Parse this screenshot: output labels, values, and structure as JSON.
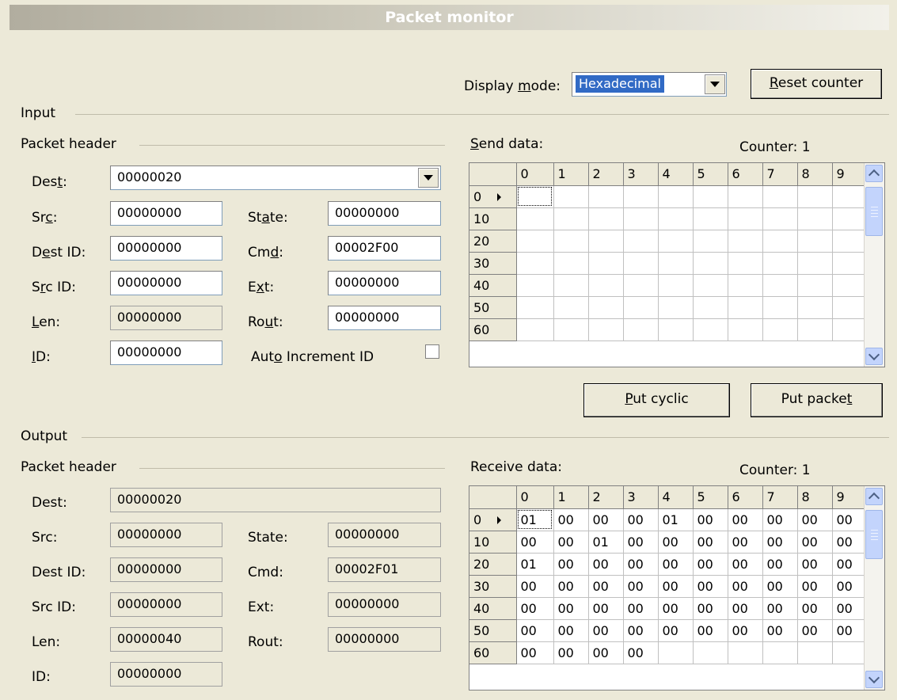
{
  "window": {
    "title": "Packet monitor"
  },
  "display_mode": {
    "label": "Display mode:",
    "value": "Hexadecimal"
  },
  "reset_counter": "Reset counter",
  "input": {
    "group": "Input",
    "header_group": "Packet header",
    "dest_label": "Dest:",
    "dest": "00000020",
    "src_label": "Src:",
    "src": "00000000",
    "dest_id_label": "Dest ID:",
    "dest_id": "00000000",
    "src_id_label": "Src ID:",
    "src_id": "00000000",
    "len_label": "Len:",
    "len": "00000000",
    "id_label": "ID:",
    "id": "00000000",
    "state_label": "State:",
    "state": "00000000",
    "cmd_label": "Cmd:",
    "cmd": "00002F00",
    "ext_label": "Ext:",
    "ext": "00000000",
    "rout_label": "Rout:",
    "rout": "00000000",
    "auto_increment_label": "Auto Increment ID",
    "send_data_label": "Send data:",
    "counter": "Counter: 1",
    "columns": [
      "0",
      "1",
      "2",
      "3",
      "4",
      "5",
      "6",
      "7",
      "8",
      "9"
    ],
    "rows": [
      {
        "label": "0",
        "cells": [
          "",
          "",
          "",
          "",
          "",
          "",
          "",
          "",
          "",
          ""
        ]
      },
      {
        "label": "10",
        "cells": [
          "",
          "",
          "",
          "",
          "",
          "",
          "",
          "",
          "",
          ""
        ]
      },
      {
        "label": "20",
        "cells": [
          "",
          "",
          "",
          "",
          "",
          "",
          "",
          "",
          "",
          ""
        ]
      },
      {
        "label": "30",
        "cells": [
          "",
          "",
          "",
          "",
          "",
          "",
          "",
          "",
          "",
          ""
        ]
      },
      {
        "label": "40",
        "cells": [
          "",
          "",
          "",
          "",
          "",
          "",
          "",
          "",
          "",
          ""
        ]
      },
      {
        "label": "50",
        "cells": [
          "",
          "",
          "",
          "",
          "",
          "",
          "",
          "",
          "",
          ""
        ]
      },
      {
        "label": "60",
        "cells": [
          "",
          "",
          "",
          "",
          "",
          "",
          "",
          "",
          "",
          ""
        ]
      }
    ]
  },
  "buttons": {
    "put_cyclic": "Put cyclic",
    "put_packet": "Put packet"
  },
  "output": {
    "group": "Output",
    "header_group": "Packet header",
    "dest_label": "Dest:",
    "dest": "00000020",
    "src_label": "Src:",
    "src": "00000000",
    "dest_id_label": "Dest ID:",
    "dest_id": "00000000",
    "src_id_label": "Src ID:",
    "src_id": "00000000",
    "len_label": "Len:",
    "len": "00000040",
    "id_label": "ID:",
    "id": "00000000",
    "state_label": "State:",
    "state": "00000000",
    "cmd_label": "Cmd:",
    "cmd": "00002F01",
    "ext_label": "Ext:",
    "ext": "00000000",
    "rout_label": "Rout:",
    "rout": "00000000",
    "receive_data_label": "Receive data:",
    "counter": "Counter: 1",
    "columns": [
      "0",
      "1",
      "2",
      "3",
      "4",
      "5",
      "6",
      "7",
      "8",
      "9"
    ],
    "rows": [
      {
        "label": "0",
        "cells": [
          "01",
          "00",
          "00",
          "00",
          "01",
          "00",
          "00",
          "00",
          "00",
          "00"
        ]
      },
      {
        "label": "10",
        "cells": [
          "00",
          "00",
          "01",
          "00",
          "00",
          "00",
          "00",
          "00",
          "00",
          "00"
        ]
      },
      {
        "label": "20",
        "cells": [
          "01",
          "00",
          "00",
          "00",
          "00",
          "00",
          "00",
          "00",
          "00",
          "00"
        ]
      },
      {
        "label": "30",
        "cells": [
          "00",
          "00",
          "00",
          "00",
          "00",
          "00",
          "00",
          "00",
          "00",
          "00"
        ]
      },
      {
        "label": "40",
        "cells": [
          "00",
          "00",
          "00",
          "00",
          "00",
          "00",
          "00",
          "00",
          "00",
          "00"
        ]
      },
      {
        "label": "50",
        "cells": [
          "00",
          "00",
          "00",
          "00",
          "00",
          "00",
          "00",
          "00",
          "00",
          "00"
        ]
      },
      {
        "label": "60",
        "cells": [
          "00",
          "00",
          "00",
          "00",
          "",
          "",
          "",
          "",
          "",
          ""
        ]
      }
    ]
  }
}
